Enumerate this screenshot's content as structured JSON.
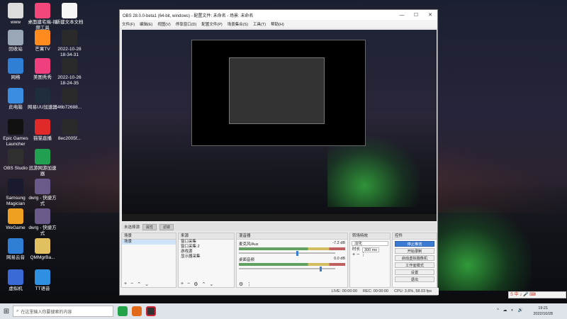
{
  "desktop": {
    "icons": [
      {
        "label": "www",
        "color": "#dcdcdc"
      },
      {
        "label": "桌面建宅端-视频工具",
        "color": "#f1477a"
      },
      {
        "label": "新建文本文档",
        "color": "#f5f5f5"
      },
      {
        "label": "回收站",
        "color": "#9aa7b5"
      },
      {
        "label": "芒果TV",
        "color": "#ff8a1d"
      },
      {
        "label": "2022-10-28 18-34-31",
        "color": "#2a2a2a"
      },
      {
        "label": "网络",
        "color": "#2f7fd6"
      },
      {
        "label": "美图秀秀",
        "color": "#ef3f7f"
      },
      {
        "label": "2022-10-26 18-24-35",
        "color": "#2a2a2a"
      },
      {
        "label": "此电脑",
        "color": "#3a8de0"
      },
      {
        "label": "网易UU加速器",
        "color": "#1f2d3d"
      },
      {
        "label": "46b72688...",
        "color": "#2a2a2a"
      },
      {
        "label": "Epic Games Launcher",
        "color": "#111111"
      },
      {
        "label": "猫猫直播",
        "color": "#e02a2a"
      },
      {
        "label": "8ec2005f...",
        "color": "#2a2a2a"
      },
      {
        "label": "OBS Studio",
        "color": "#303030"
      },
      {
        "label": "迅游网游加速器",
        "color": "#20a050"
      },
      {
        "label": "Samsung Magician",
        "color": "#1a1a2e"
      },
      {
        "label": "dwrg - 快捷方式",
        "color": "#6a5a8a"
      },
      {
        "label": "WeGame",
        "color": "#f0a020"
      },
      {
        "label": "dwrg - 快捷方式",
        "color": "#6a5a8a"
      },
      {
        "label": "网易云音",
        "color": "#2f7fd6"
      },
      {
        "label": "QMMgrBa...",
        "color": "#e0c060"
      },
      {
        "label": "虚拟机",
        "color": "#3a6ad6"
      },
      {
        "label": "TT语音",
        "color": "#2f8fe0"
      }
    ]
  },
  "obs": {
    "title": "OBS 28.0.0-beta1 (64-bit, windows) - 配置文件: 未命名 - 场景: 未命名",
    "menu": [
      "文件(F)",
      "编辑(E)",
      "视图(V)",
      "停靠窗口(D)",
      "配置文件(P)",
      "场景集合(S)",
      "工具(T)",
      "帮助(H)"
    ],
    "status_line": {
      "left": "未选择源",
      "btn1": "属性",
      "btn2": "滤镜"
    },
    "docks": {
      "scenes": {
        "title": "场景",
        "items": [
          "场景"
        ]
      },
      "sources": {
        "title": "来源",
        "items": [
          "窗口采集",
          "窗口采集 2",
          "游戏源",
          "显示器采集"
        ]
      },
      "mixer": {
        "title": "混音器",
        "tracks": [
          {
            "name": "麦克风/Aux",
            "db": "-7.2 dB",
            "level": 0.62
          },
          {
            "name": "桌面音频",
            "db": "0.0 dB",
            "level": 0.88
          }
        ]
      },
      "transitions": {
        "title": "转场特效",
        "type": "淡化",
        "duration_label": "时长",
        "duration": "300 ms"
      },
      "controls": {
        "title": "控件",
        "buttons": [
          "停止推流",
          "开始录制",
          "启动虚拟摄像机",
          "工作室模式",
          "设置",
          "退出"
        ]
      }
    },
    "statusbar": {
      "live": "LIVE: 00:00:00",
      "rec": "REC: 00:00:00",
      "cpu": "CPU: 3.6%, 58.03 fps"
    }
  },
  "taskbar": {
    "search_placeholder": "在这里输入你要搜索的内容",
    "time": "19:21",
    "date": "2022/10/28",
    "ime": "S 中 ♪ 🎤 ⌨"
  }
}
